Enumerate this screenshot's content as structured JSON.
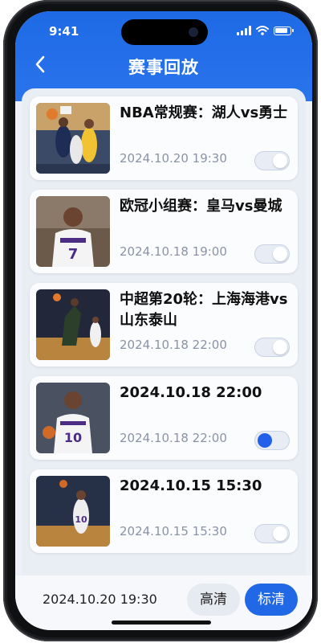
{
  "status_bar": {
    "time": "9:41"
  },
  "header": {
    "title": "赛事回放",
    "back_icon": "chevron-left-icon"
  },
  "accent_color": "#2168e6",
  "items": [
    {
      "title": "NBA常规赛：湖人vs勇士",
      "date": "2024.10.20 19:30",
      "toggle_on": false
    },
    {
      "title": "欧冠小组赛：皇马vs曼城",
      "date": "2024.10.18 19:00",
      "toggle_on": false
    },
    {
      "title": "中超第20轮：上海海港vs山东泰山",
      "date": "2024.10.18 22:00",
      "toggle_on": false
    },
    {
      "title": "2024.10.18 22:00",
      "date": "2024.10.18 22:00",
      "toggle_on": true
    },
    {
      "title": "2024.10.15 15:30",
      "date": "2024.10.15 15:30",
      "toggle_on": false
    }
  ],
  "bottom_bar": {
    "selected_date": "2024.10.20 19:30",
    "hd_label": "高清",
    "sd_label": "标清",
    "selected_quality": "标清"
  }
}
